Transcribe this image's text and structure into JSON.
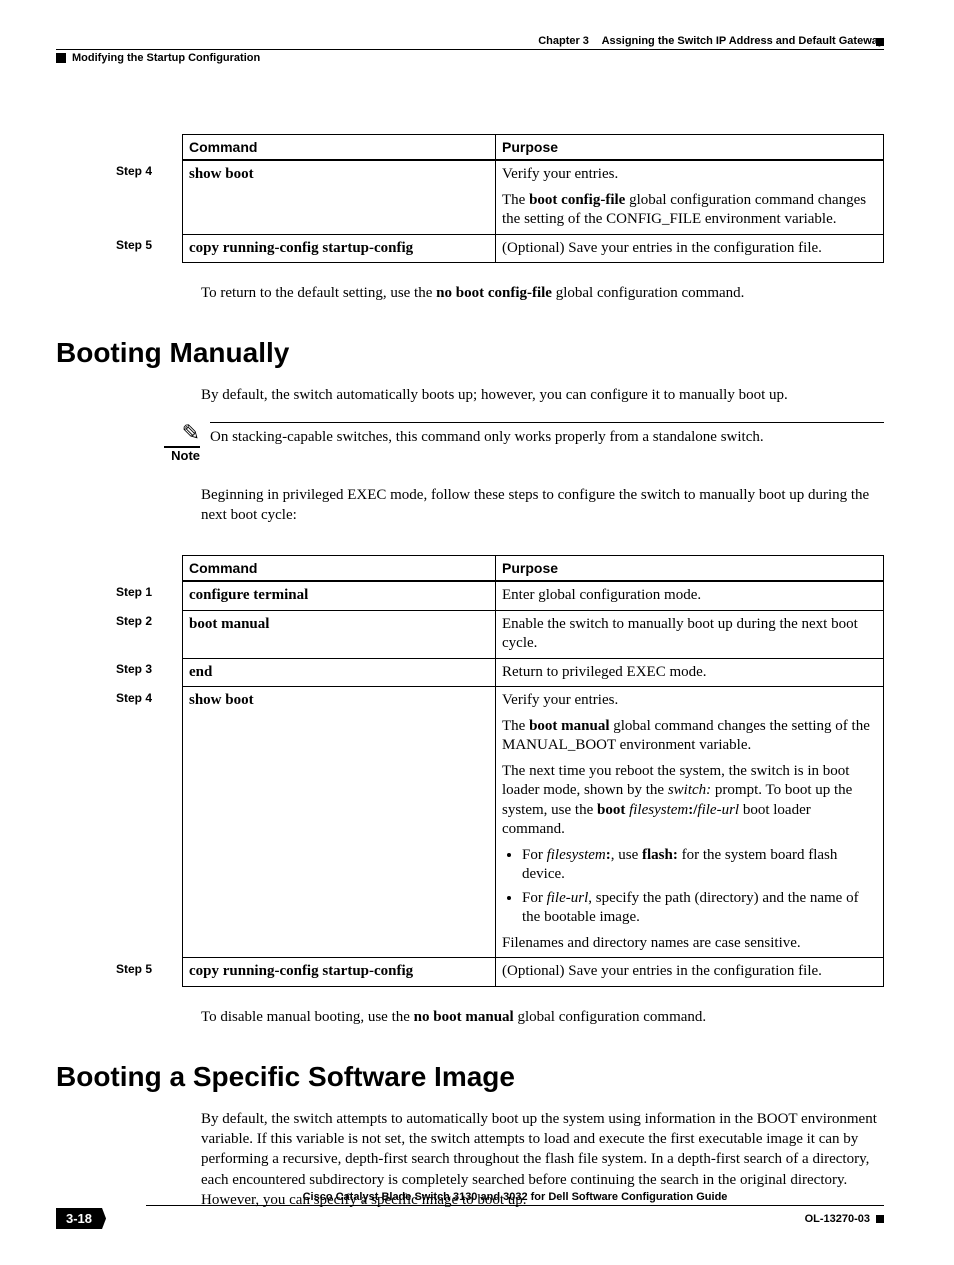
{
  "header": {
    "chapter": "Chapter 3",
    "title": "Assigning the Switch IP Address and Default Gateway",
    "section_left": "Modifying the Startup Configuration"
  },
  "table1": {
    "th_command": "Command",
    "th_purpose": "Purpose",
    "rows": [
      {
        "step": "Step 4",
        "command": "show boot",
        "p1": "Verify your entries.",
        "p2a": "The ",
        "p2b": "boot config-file",
        "p2c": " global configuration command changes the setting of the CONFIG_FILE environment variable."
      },
      {
        "step": "Step 5",
        "command": "copy running-config startup-config",
        "p1": "(Optional) Save your entries in the configuration file."
      }
    ]
  },
  "para1a": "To return to the default setting, use the ",
  "para1b": "no boot config-file",
  "para1c": " global configuration command.",
  "h2_1": "Booting Manually",
  "para2": "By default, the switch automatically boots up; however, you can configure it to manually boot up.",
  "note_label": "Note",
  "note_text": "On stacking-capable switches, this command only works properly from a standalone switch.",
  "para3": "Beginning in privileged EXEC mode, follow these steps to configure the switch to manually boot up during the next boot cycle:",
  "table2": {
    "th_command": "Command",
    "th_purpose": "Purpose",
    "r1": {
      "step": "Step 1",
      "command": "configure terminal",
      "p1": "Enter global configuration mode."
    },
    "r2": {
      "step": "Step 2",
      "command": "boot manual",
      "p1": "Enable the switch to manually boot up during the next boot cycle."
    },
    "r3": {
      "step": "Step 3",
      "command": "end",
      "p1": "Return to privileged EXEC mode."
    },
    "r4": {
      "step": "Step 4",
      "command": "show boot",
      "p1": "Verify your entries.",
      "p2a": "The ",
      "p2b": "boot manual",
      "p2c": " global command changes the setting of the MANUAL_BOOT environment variable.",
      "p3a": "The next time you reboot the system, the switch is in boot loader mode, shown by the ",
      "p3b": "switch:",
      "p3c": " prompt. To boot up the system, use the ",
      "p3d": "boot",
      "p3e": " ",
      "p3f": "filesystem",
      "p3g": ":",
      "p3h": "/",
      "p3i": "file-url",
      "p3j": " boot loader command.",
      "li1a": "For ",
      "li1b": "filesystem",
      "li1c": ":",
      "li1d": ", use ",
      "li1e": "flash:",
      "li1f": " for the system board flash device.",
      "li2a": "For ",
      "li2b": "file-url",
      "li2c": ", specify the path (directory) and the name of the bootable image.",
      "p4": "Filenames and directory names are case sensitive."
    },
    "r5": {
      "step": "Step 5",
      "command": "copy running-config startup-config",
      "p1": "(Optional) Save your entries in the configuration file."
    }
  },
  "para4a": "To disable manual booting, use the ",
  "para4b": "no boot manual",
  "para4c": " global configuration command.",
  "h2_2": "Booting a Specific Software Image",
  "para5": "By default, the switch attempts to automatically boot up the system using information in the BOOT environment variable. If this variable is not set, the switch attempts to load and execute the first executable image it can by performing a recursive, depth-first search throughout the flash file system. In a depth-first search of a directory, each encountered subdirectory is completely searched before continuing the search in the original directory. However, you can specify a specific image to boot up.",
  "footer": {
    "book": "Cisco Catalyst Blade Switch 3130 and 3032 for Dell Software Configuration Guide",
    "page": "3-18",
    "doc_id": "OL-13270-03"
  }
}
